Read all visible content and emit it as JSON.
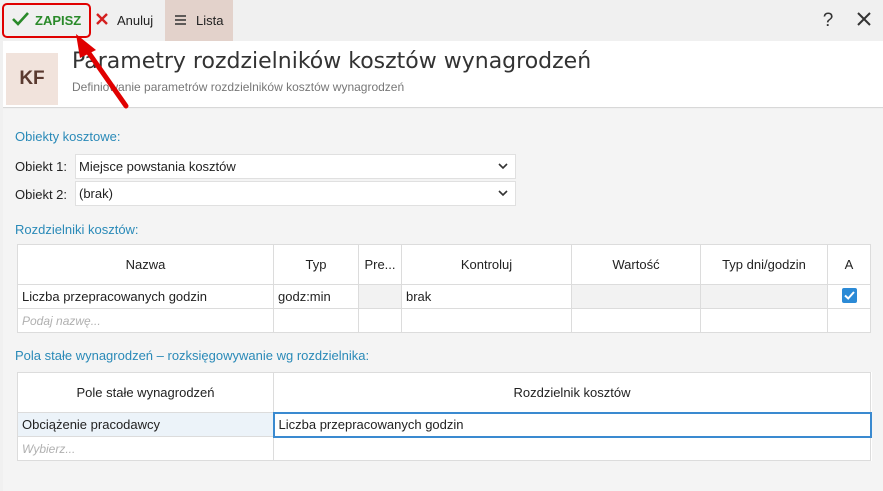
{
  "toolbar": {
    "save_label": "ZAPISZ",
    "cancel_label": "Anuluj",
    "list_label": "Lista",
    "help_label": "?"
  },
  "header": {
    "badge": "KF",
    "title": "Parametry rozdzielników kosztów wynagrodzeń",
    "subtitle": "Definiowanie parametrów rozdzielników kosztów wynagrodzeń"
  },
  "cost_objects": {
    "title": "Obiekty kosztowe:",
    "object1_label": "Obiekt 1:",
    "object1_value": "Miejsce powstania kosztów",
    "object2_label": "Obiekt 2:",
    "object2_value": "(brak)"
  },
  "distributors": {
    "title": "Rozdzielniki kosztów:",
    "columns": [
      "Nazwa",
      "Typ",
      "Pre...",
      "Kontroluj",
      "Wartość",
      "Typ dni/godzin",
      "A"
    ],
    "rows": [
      {
        "name": "Liczba przepracowanych godzin",
        "type": "godz:min",
        "pre": "",
        "control": "brak",
        "value": "",
        "day_type": "",
        "a_checked": true
      }
    ],
    "placeholder": "Podaj nazwę..."
  },
  "fixed": {
    "title": "Pola stałe wynagrodzeń – rozksięgowywanie wg rozdzielnika:",
    "columns": [
      "Pole stałe wynagrodzeń",
      "Rozdzielnik kosztów"
    ],
    "rows": [
      {
        "field": "Obciążenie pracodawcy",
        "distributor": "Liczba przepracowanych godzin"
      }
    ],
    "placeholder": "Wybierz..."
  },
  "colors": {
    "accent": "#2a8ab8",
    "save_green": "#2a8a2a",
    "highlight_red": "#e00000",
    "checkbox_blue": "#2b8ad6"
  }
}
